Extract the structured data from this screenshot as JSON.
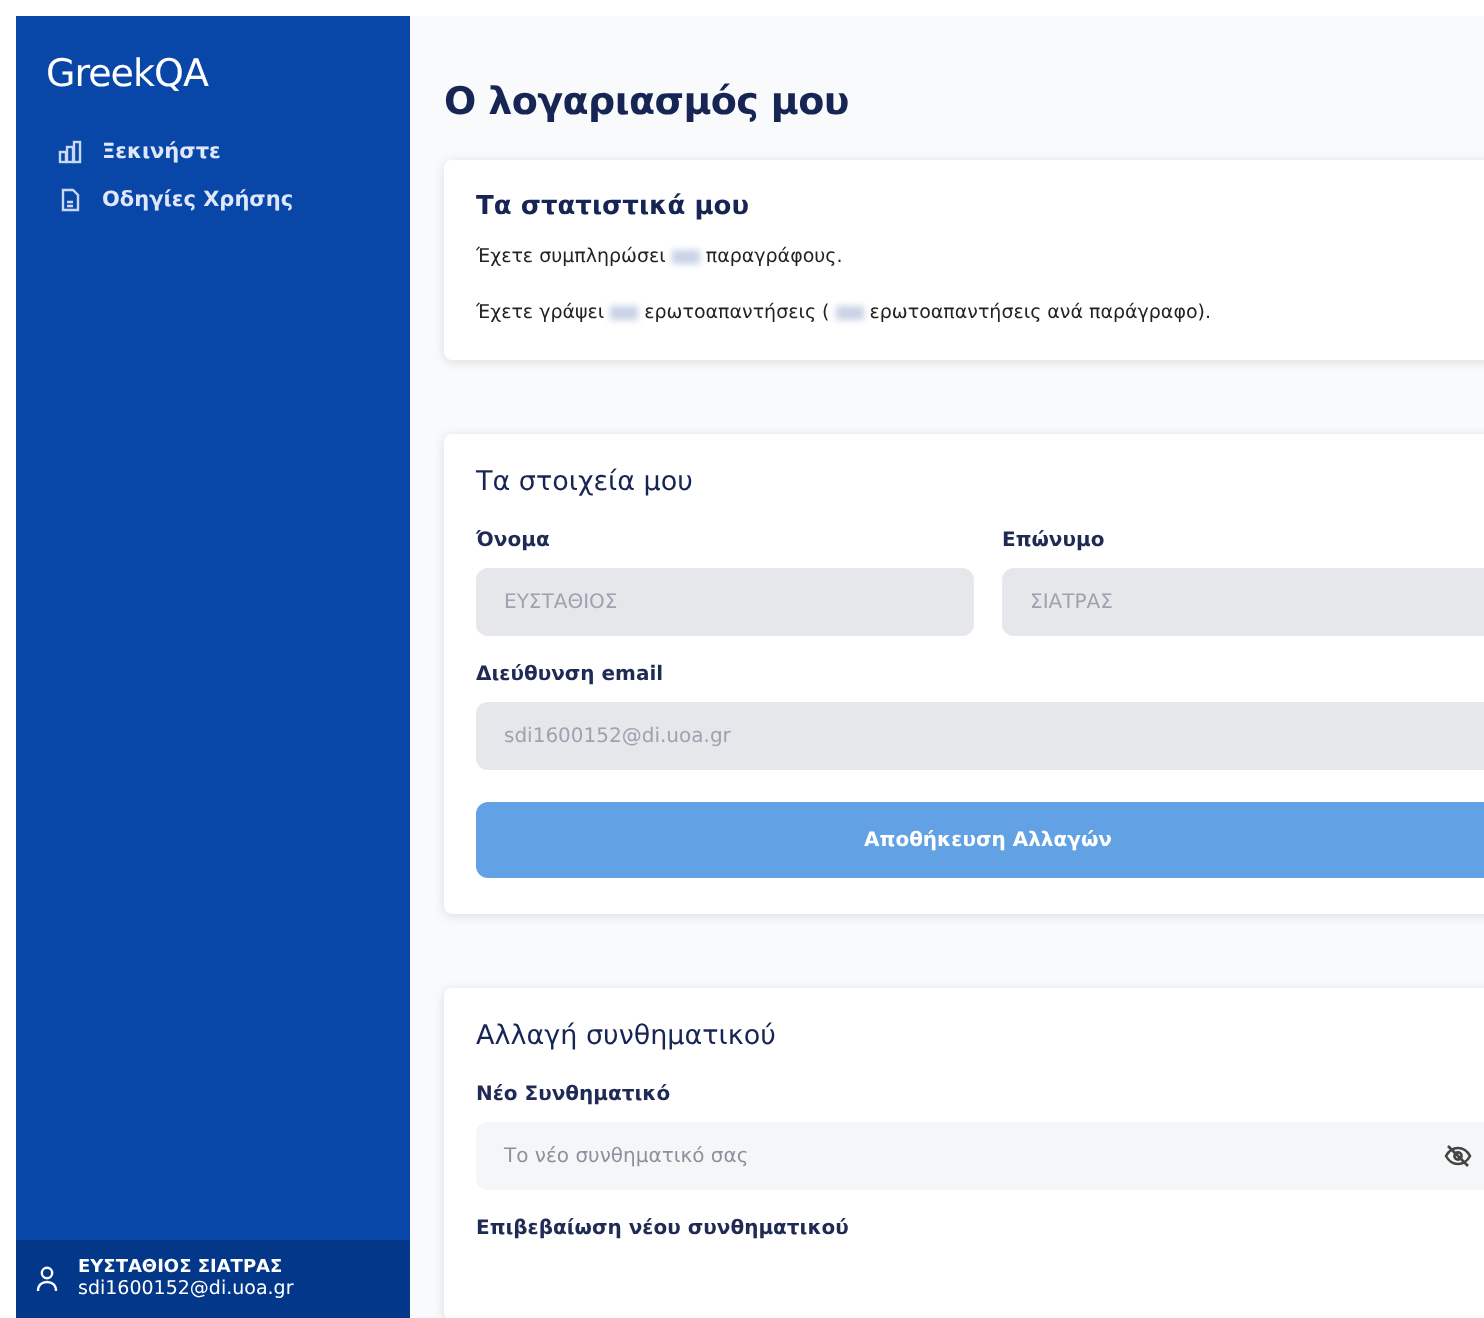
{
  "sidebar": {
    "logo": "GreekQA",
    "items": [
      {
        "label": "Ξεκινήστε"
      },
      {
        "label": "Οδηγίες Χρήσης"
      }
    ],
    "user": {
      "name": "ΕΥΣΤΑΘΙΟΣ ΣΙΑΤΡΑΣ",
      "email": "sdi1600152@di.uoa.gr"
    }
  },
  "page_title": "Ο λογαριασμός μου",
  "cards": [
    {
      "kind": "stats",
      "title": "Τα στατιστικά μου",
      "sentences": [
        [
          {
            "kind": "text",
            "text": "Έχετε συμπληρώσει"
          },
          {
            "kind": "redacted"
          },
          {
            "kind": "text",
            "text": "παραγράφους."
          }
        ],
        [
          {
            "kind": "text",
            "text": "Έχετε γράψει"
          },
          {
            "kind": "redacted"
          },
          {
            "kind": "text",
            "text": "ερωτοαπαντήσεις ("
          },
          {
            "kind": "redacted"
          },
          {
            "kind": "text",
            "text": "ερωτοαπαντήσεις ανά παράγραφο)."
          }
        ]
      ]
    },
    {
      "kind": "form",
      "title": "Τα στοιχεία μου",
      "rows": [
        [
          {
            "label": "Όνομα",
            "value": "ΕΥΣΤΑΘΙΟΣ",
            "disabled": true
          },
          {
            "label": "Επώνυμο",
            "value": "ΣΙΑΤΡΑΣ",
            "disabled": true
          }
        ],
        [
          {
            "label": "Διεύθυνση email",
            "value": "sdi1600152@di.uoa.gr",
            "disabled": true
          }
        ]
      ],
      "button": {
        "label": "Αποθήκευση Αλλαγών",
        "disabled": true
      }
    },
    {
      "kind": "form",
      "title": "Αλλαγή συνθηματικού",
      "rows": [
        [
          {
            "label": "Νέο Συνθηματικό",
            "placeholder": "Το νέο συνθηματικό σας",
            "disabled": false,
            "reveal_toggle": true
          }
        ],
        [
          {
            "label": "Επιβεβαίωση νέου συνθηματικού"
          }
        ]
      ]
    }
  ]
}
